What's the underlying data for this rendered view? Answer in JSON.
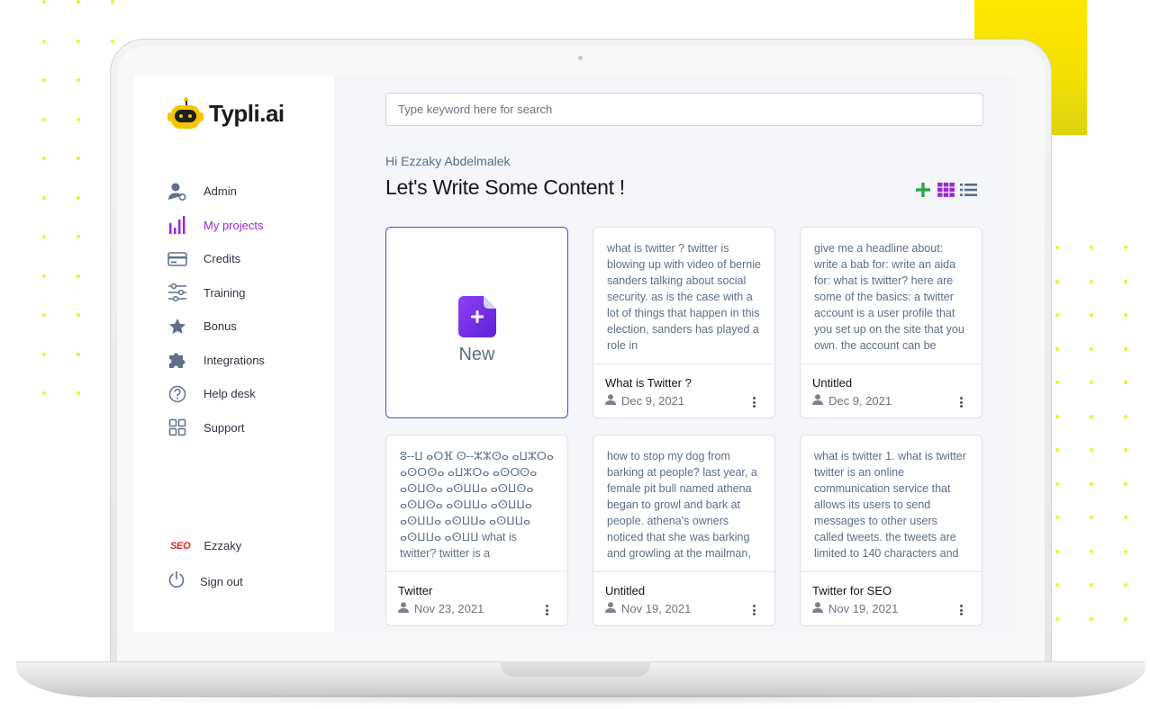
{
  "brand": {
    "name": "Typli.ai"
  },
  "sidebar": {
    "items": [
      {
        "label": "Admin",
        "icon": "user-gear-icon",
        "active": false
      },
      {
        "label": "My projects",
        "icon": "bar-chart-icon",
        "active": true
      },
      {
        "label": "Credits",
        "icon": "credit-card-icon",
        "active": false
      },
      {
        "label": "Training",
        "icon": "sliders-icon",
        "active": false
      },
      {
        "label": "Bonus",
        "icon": "star-icon",
        "active": false
      },
      {
        "label": "Integrations",
        "icon": "puzzle-icon",
        "active": false
      },
      {
        "label": "Help desk",
        "icon": "question-circle-icon",
        "active": false
      },
      {
        "label": "Support",
        "icon": "grid-icon",
        "active": false
      }
    ],
    "user": {
      "badge": "SEO",
      "name": "Ezzaky"
    },
    "signout_label": "Sign out"
  },
  "search": {
    "placeholder": "Type keyword here for search"
  },
  "greeting": "Hi Ezzaky Abdelmalek",
  "heading": "Let's Write Some Content !",
  "toolbar": {
    "icons": [
      "plus-icon",
      "grid-view-icon",
      "list-view-icon"
    ]
  },
  "new_card": {
    "label": "New"
  },
  "projects": [
    {
      "excerpt": "what is twitter ? twitter is blowing up with video of bernie sanders talking about social security. as is the case with a lot of things that happen in this election, sanders has played a role in",
      "title": "What is Twitter ?",
      "date": "Dec 9, 2021"
    },
    {
      "excerpt": "give me a headline about: write a bab for: write an aida for: what is twitter? here are some of the basics: a twitter account is a user profile that you set up on the site that you own. the account can be",
      "title": "Untitled",
      "date": "Dec 9, 2021"
    },
    {
      "excerpt": "ⵓ--ⵡ ⴰⵔⴼ ⵙ--ⵣⵣⵙⴰ ⴰⵡⵣⵔⴰ ⴰⵙⵔⵙⴰ ⴰⵡⵣⵔⴰ ⴰⵙⵔⵙⴰ ⴰⵙⵡⵙⴰ ⴰⵙⵡⵡⴰ ⴰⵙⵡⵙⴰ ⴰⵙⵡⵙⴰ ⴰⵙⵡⵡⴰ ⴰⵙⵡⵡⴰ ⴰⵙⵡⵡⴰ ⴰⵙⵡⵡⴰ ⴰⵙⵡⵡⴰ ⴰⵙⵡⵡⴰ ⴰⵙⵡⵡ what is twitter? twitter is a microblogging and social",
      "title": "Twitter",
      "date": "Nov 23, 2021"
    },
    {
      "excerpt": "how to stop my dog from barking at people? last year, a female pit bull named athena began to growl and bark at people. athena's owners noticed that she was barking and growling at the mailman,",
      "title": "Untitled",
      "date": "Nov 19, 2021"
    },
    {
      "excerpt": "what is twitter 1. what is twitter twitter is an online communication service that allows its users to send messages to other users called tweets. the tweets are limited to 140 characters and",
      "title": "Twitter for SEO",
      "date": "Nov 19, 2021"
    }
  ],
  "colors": {
    "accent": "#9b27d4",
    "new_icon": "#7b2ff0",
    "plus": "#28a745",
    "grid_view": "#9b27d4",
    "list_view": "#5b6b8c",
    "highlight_block": "#ffe700"
  }
}
